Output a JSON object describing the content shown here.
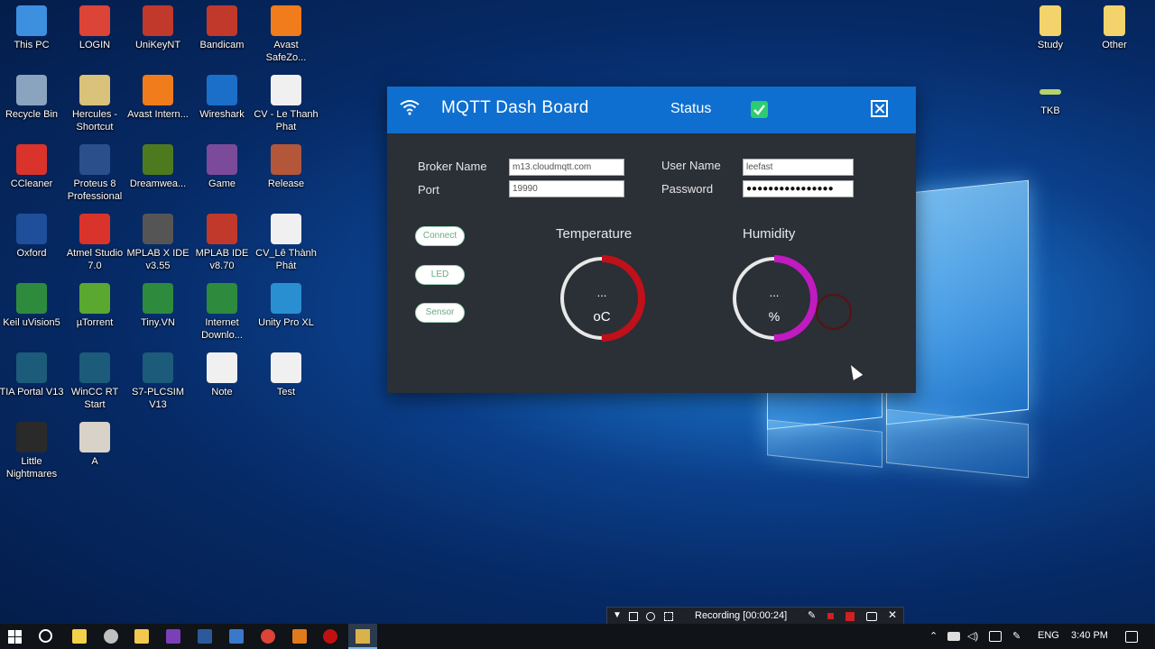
{
  "desktop_icons_left": [
    {
      "label": "This PC",
      "icon": "monitor-icon",
      "color": "#3d8fe0"
    },
    {
      "label": "LOGIN",
      "icon": "chrome-icon",
      "color": "#db4437"
    },
    {
      "label": "UniKeyNT",
      "icon": "unikey-icon",
      "color": "#c0392b"
    },
    {
      "label": "Bandicam",
      "icon": "bandicam-icon",
      "color": "#c0392b"
    },
    {
      "label": "Avast SafeZo...",
      "icon": "avast-safezone-icon",
      "color": "#f07c1b"
    },
    {
      "label": "Recycle Bin",
      "icon": "recycle-bin-icon",
      "color": "#8aa4bf"
    },
    {
      "label": "Hercules - Shortcut",
      "icon": "hercules-icon",
      "color": "#d9c27a"
    },
    {
      "label": "Avast Intern...",
      "icon": "avast-icon",
      "color": "#f07c1b"
    },
    {
      "label": "Wireshark",
      "icon": "wireshark-icon",
      "color": "#1b6fc9"
    },
    {
      "label": "CV - Le Thanh Phat",
      "icon": "document-icon",
      "color": "#f0f0f0"
    },
    {
      "label": "CCleaner",
      "icon": "ccleaner-icon",
      "color": "#d9332b"
    },
    {
      "label": "Proteus 8 Professional",
      "icon": "proteus-icon",
      "color": "#2b4f8a"
    },
    {
      "label": "Dreamwea...",
      "icon": "dreamweaver-icon",
      "color": "#4e7a1f"
    },
    {
      "label": "Game",
      "icon": "winrar-icon",
      "color": "#7b4b9a"
    },
    {
      "label": "Release",
      "icon": "winrar-icon",
      "color": "#b3563a"
    },
    {
      "label": "Oxford",
      "icon": "oxford-icon",
      "color": "#1f4f9a"
    },
    {
      "label": "Atmel Studio 7.0",
      "icon": "atmel-icon",
      "color": "#d9332b"
    },
    {
      "label": "MPLAB X IDE v3.55",
      "icon": "mplab-x-icon",
      "color": "#555555"
    },
    {
      "label": "MPLAB IDE v8.70",
      "icon": "mplab-icon",
      "color": "#c0392b"
    },
    {
      "label": "CV_Lê Thành Phát",
      "icon": "document-icon",
      "color": "#f0f0f0"
    },
    {
      "label": "Keil uVision5",
      "icon": "keil-icon",
      "color": "#2e8b3e"
    },
    {
      "label": "µTorrent",
      "icon": "utorrent-icon",
      "color": "#5aa830"
    },
    {
      "label": "Tiny.VN",
      "icon": "tinyvn-icon",
      "color": "#2e8b3e"
    },
    {
      "label": "Internet Downlo...",
      "icon": "idm-icon",
      "color": "#2e8b3e"
    },
    {
      "label": "Unity Pro XL",
      "icon": "unity-pro-icon",
      "color": "#2a8fd0"
    },
    {
      "label": "TIA Portal V13",
      "icon": "tia-portal-icon",
      "color": "#1c5b7a"
    },
    {
      "label": "WinCC RT Start",
      "icon": "wincc-icon",
      "color": "#1c5b7a"
    },
    {
      "label": "S7-PLCSIM V13",
      "icon": "plcsim-icon",
      "color": "#1c5b7a"
    },
    {
      "label": "Note",
      "icon": "document-icon",
      "color": "#f0f0f0"
    },
    {
      "label": "Test",
      "icon": "document-icon",
      "color": "#f0f0f0"
    },
    {
      "label": "Little Nightmares",
      "icon": "little-nightmares-icon",
      "color": "#2a2a2a"
    },
    {
      "label": "A",
      "icon": "image-icon",
      "color": "#d8d2c8"
    }
  ],
  "desktop_icons_right": [
    {
      "label": "Study",
      "icon": "folder-icon",
      "color": "#f3d36b"
    },
    {
      "label": "Other",
      "icon": "folder-icon",
      "color": "#f3d36b"
    },
    {
      "label": "TKB",
      "icon": "file-icon",
      "color": "#b6d36b"
    }
  ],
  "mqtt": {
    "title": "MQTT Dash Board",
    "status_label": "Status",
    "status_color": "#2ecc71",
    "broker_label": "Broker Name",
    "broker_value": "m13.cloudmqtt.com",
    "port_label": "Port",
    "port_value": "19990",
    "user_label": "User Name",
    "user_value": "leefast",
    "password_label": "Password",
    "password_value": "●●●●●●●●●●●●●●●●",
    "buttons": [
      "Connect",
      "LED",
      "Sensor"
    ],
    "temperature": {
      "title": "Temperature",
      "value": "...",
      "unit": "oC",
      "color": "#c0101a",
      "fill": 0.5
    },
    "humidity": {
      "title": "Humidity",
      "value": "...",
      "unit": "%",
      "color": "#c01ac0",
      "fill": 0.5
    }
  },
  "recording": {
    "text": "Recording [00:00:24]"
  },
  "taskbar": {
    "language": "ENG",
    "time": "3:40 PM"
  }
}
